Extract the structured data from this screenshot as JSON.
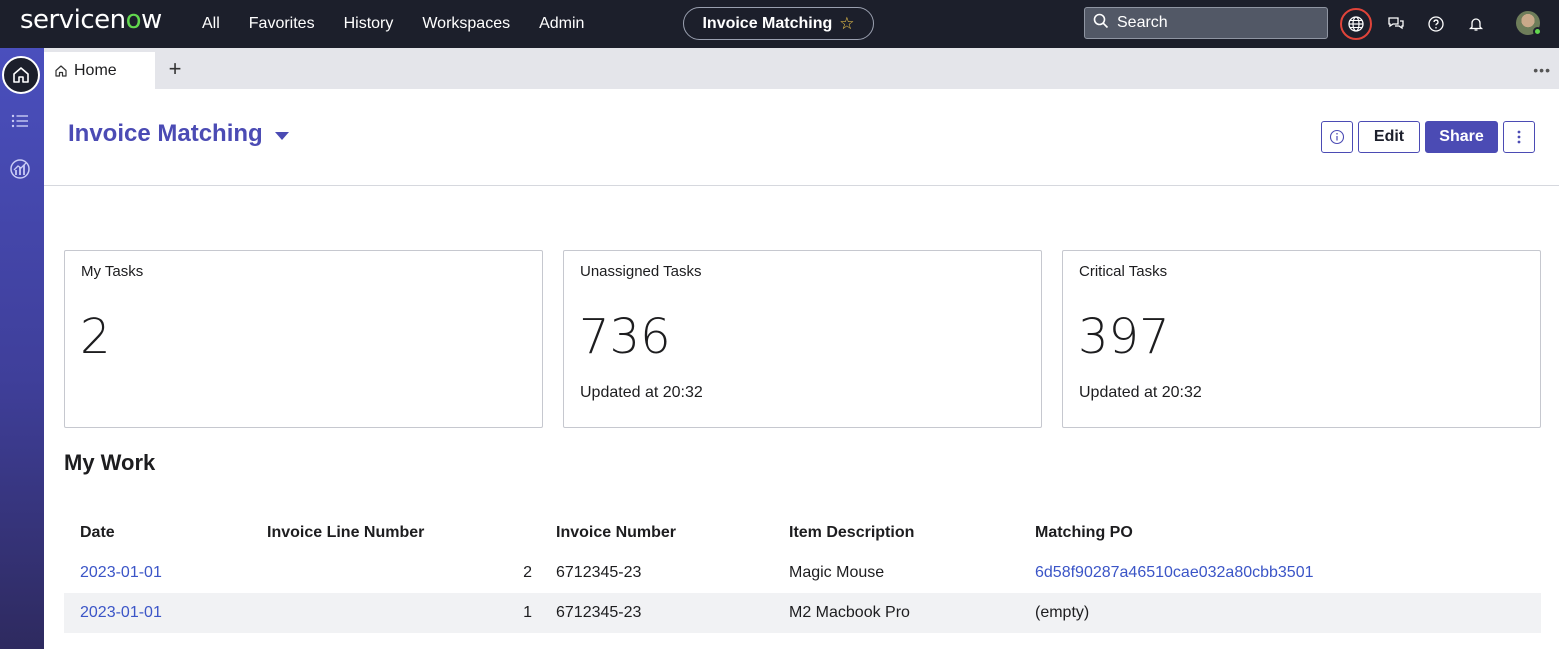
{
  "topbar": {
    "logo": "servicenow",
    "nav": [
      "All",
      "Favorites",
      "History",
      "Workspaces",
      "Admin"
    ],
    "workspace_title": "Invoice Matching",
    "search_placeholder": "Search"
  },
  "tabs": {
    "home_label": "Home"
  },
  "page": {
    "title": "Invoice Matching",
    "edit_label": "Edit",
    "share_label": "Share"
  },
  "cards": [
    {
      "label": "My Tasks",
      "value": "2",
      "updated": ""
    },
    {
      "label": "Unassigned Tasks",
      "value": "736",
      "updated": "Updated at 20:32"
    },
    {
      "label": "Critical Tasks",
      "value": "397",
      "updated": "Updated at 20:32"
    }
  ],
  "my_work": {
    "title": "My Work",
    "columns": [
      "Date",
      "Invoice Line Number",
      "Invoice Number",
      "Item Description",
      "Matching PO"
    ],
    "rows": [
      {
        "date": "2023-01-01",
        "line": "2",
        "invoice": "6712345-23",
        "item": "Magic Mouse",
        "po": "6d58f90287a46510cae032a80cbb3501"
      },
      {
        "date": "2023-01-01",
        "line": "1",
        "invoice": "6712345-23",
        "item": "M2 Macbook Pro",
        "po": "(empty)"
      }
    ]
  }
}
